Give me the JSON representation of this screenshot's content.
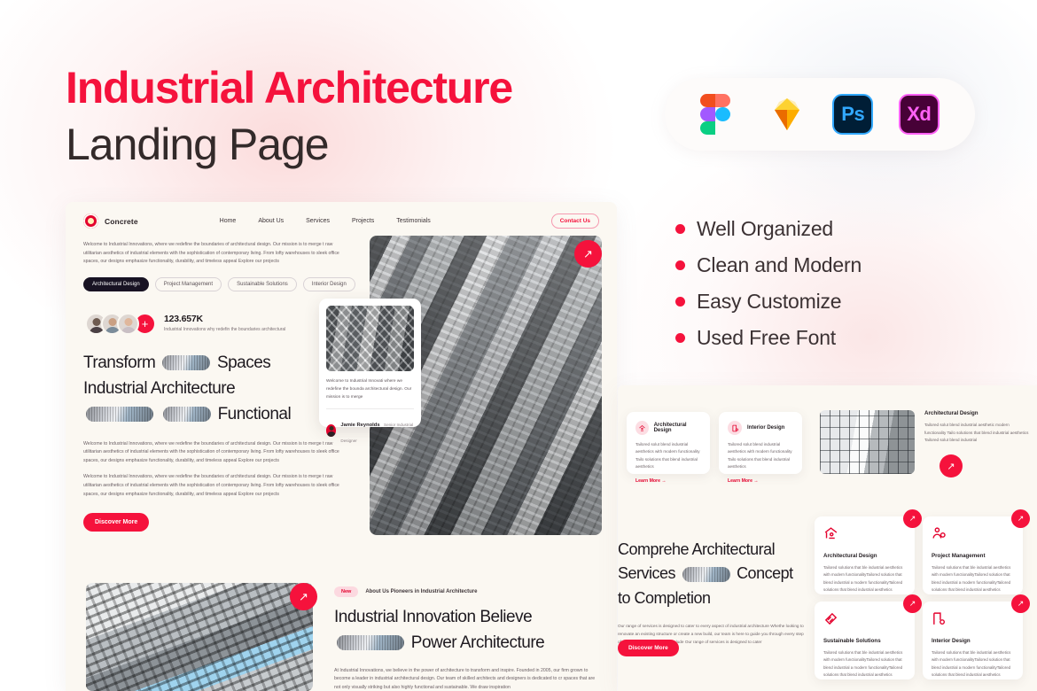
{
  "poster": {
    "title_line1": "Industrial Architecture",
    "title_line2": "Landing Page",
    "accent_color": "#f5123c",
    "title_dark_color": "#332a2a"
  },
  "app_bar": {
    "icons": [
      {
        "name": "figma-icon",
        "label": "Figma"
      },
      {
        "name": "sketch-icon",
        "label": "Sketch"
      },
      {
        "name": "photoshop-icon",
        "label": "Ps"
      },
      {
        "name": "xd-icon",
        "label": "Xd"
      }
    ]
  },
  "features": [
    {
      "label": "Well Organized"
    },
    {
      "label": "Clean and Modern"
    },
    {
      "label": "Easy Customize"
    },
    {
      "label": "Used Free Font"
    }
  ],
  "mock_left": {
    "nav": {
      "brand": "Concrete",
      "links": [
        "Home",
        "About Us",
        "Services",
        "Projects",
        "Testimonials"
      ],
      "cta": "Contact Us"
    },
    "intro_copy": "Welcome to Industrial Innovations, where we redefine the boundaries of architectural design. Our mission is to merge t raw utilitarian aesthetics of industrial elements with the sophistication of contemporary living. From lofty warehouses to sleek office spaces, our designs emphasize functionality, durability, and timeless appeal Explore our projects",
    "pills": [
      {
        "label": "Architectural Design",
        "active": true
      },
      {
        "label": "Project Management",
        "active": false
      },
      {
        "label": "Sustainable Solutions",
        "active": false
      },
      {
        "label": "Interior Design",
        "active": false
      }
    ],
    "stats": {
      "count": "123.657K",
      "caption": "Industrial Innovations why redefin the boundaries  architectural",
      "plus_label": "+"
    },
    "hero": {
      "head_part1": "Transform",
      "head_part2": "Spaces",
      "head_part3": "Industrial Architecture",
      "head_part4": "Functional",
      "paragraph_1": "Welcome to Industrial Innovations, where we redefine the boundaries of architectural design. Our mission is to merge t raw utilitarian aesthetics of industrial elements with the sophistication of contemporary living. From lofty warehouses to sleek office spaces, our designs emphasize functionality, durability, and timeless appeal Explore our projects",
      "paragraph_2": "Welcome to Industrial Innovations, where we redefine the boundaries of architectural design. Our mission is to merge t raw utilitarian aesthetics of industrial elements with the sophistication of contemporary living. From lofty warehouses to sleek office spaces, our designs emphasize functionality, durability, and timeless appeal Explore our projects",
      "cta": "Discover More",
      "fab_icon": "arrow-up-right-icon"
    },
    "testimonial": {
      "quote": "Welcome to Industrial Innovati where we redefine the bounda architectural design. Our mission is to merge",
      "name": "Jamie Reynolds",
      "role": "Senior Industrial Designer"
    },
    "about": {
      "badge": "New",
      "tagline": "About Us Pioneers in Industrial Architecture",
      "head_part1": "Industrial Innovation Believe",
      "head_part2": "Power Architecture",
      "paragraph": "At Industrial Innovations, we believe in the power of architecture to transform and inspire. Founded in 2005, our firm grown to become a leader in industrial architectural design. Our team of skilled architects and designers is dedicated to cr spaces that are not only visually striking but also highly functional and sustainable. We draw inspiration"
    }
  },
  "mock_right": {
    "mini_cards": [
      {
        "title": "Architectural Design",
        "icon": "home-person-icon",
        "body": "Tailored solut blend industrial aesthetics with modern functionality Tailo solutions that blend industrial aesthetics",
        "link": "Learn More  →"
      },
      {
        "title": "Interior Design",
        "icon": "room-gear-icon",
        "body": "Tailored solut blend industrial aesthetics with modern functionality Tailo solutions that blend industrial aesthetics",
        "link": "Learn More  →"
      }
    ],
    "feature_wide": {
      "title": "Architectural Design",
      "body": "Tailored solut blend industrial aesthetic modern functionality Tailo solutions that blend industrial aesthetics Tailored solut blend industrial",
      "fab_icon": "arrow-up-right-icon"
    },
    "services": {
      "head_part1": "Comprehe Architectural",
      "head_part2": "Services",
      "head_part3": "Concept",
      "head_part4": "to Completion",
      "paragraph": "Our range of services is designed to cater to every aspect of industrial architecture Whethe looking to renovate an existing structure or create a new build, our team is here to guide you through every step of the process. Our services include Our range of services is designed to cater",
      "cta": "Discover More"
    },
    "service_cards": [
      {
        "title": "Architectural Design",
        "icon": "home-person-icon",
        "body": "Tailored solutions that ble industrial aesthetics with modern functionalityTailored solution that blend industrial a modern functionalityTailored solutions that blend industrial aesthetics"
      },
      {
        "title": "Project Management",
        "icon": "person-gear-icon",
        "body": "Tailored solutions that ble industrial aesthetics with modern functionalityTailored solution that blend industrial a modern functionalityTailored solutions that blend industrial aesthetics"
      },
      {
        "title": "Sustainable Solutions",
        "icon": "leaf-hand-icon",
        "body": "Tailored solutions that ble industrial aesthetics with modern functionalityTailored solution that blend industrial a modern functionalityTailored solutions that blend industrial aesthetics"
      },
      {
        "title": "Interior Design",
        "icon": "room-gear-icon",
        "body": "Tailored solutions that ble industrial aesthetics with modern functionalityTailored solution that blend industrial a modern functionalityTailored solutions that blend industrial aesthetics"
      }
    ]
  }
}
